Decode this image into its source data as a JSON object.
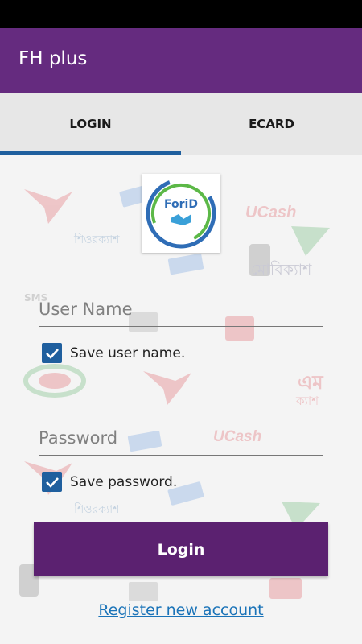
{
  "app_bar": {
    "title": "FH plus"
  },
  "tabs": [
    {
      "label": "LOGIN",
      "active": true
    },
    {
      "label": "ECARD",
      "active": false
    }
  ],
  "logo": {
    "text": "ForiD"
  },
  "background_texts": {
    "ucash": "UCash",
    "shurokkhito": "শিওরক্যাশ",
    "mobicash": "মোবিক্যাশ",
    "em": "এম",
    "cash": "ক্যাশ",
    "sms": "SMS"
  },
  "form": {
    "username_placeholder": "User Name",
    "username_value": "",
    "save_username_label": "Save user name.",
    "save_username_checked": true,
    "password_placeholder": "Password",
    "password_value": "",
    "save_password_label": "Save password.",
    "save_password_checked": true
  },
  "actions": {
    "login_label": "Login",
    "register_label": "Register new account"
  },
  "colors": {
    "app_bar": "#652b7f",
    "button": "#5b2170",
    "accent": "#1f5f9e",
    "link": "#1a73b8"
  }
}
